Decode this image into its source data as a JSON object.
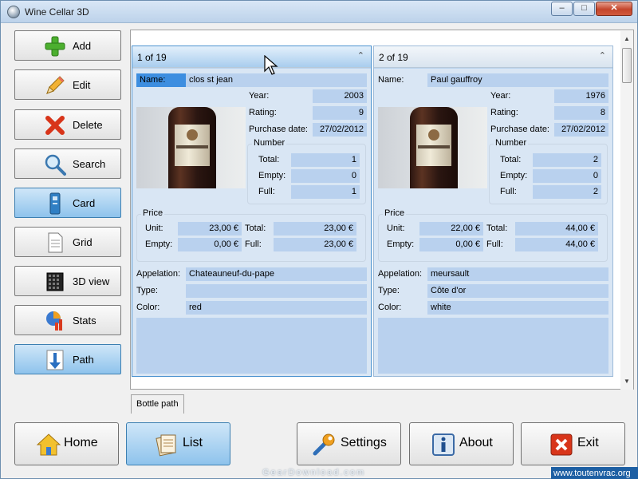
{
  "window": {
    "title": "Wine Cellar 3D",
    "minimize": "–",
    "maximize": "□",
    "close": "✕"
  },
  "tools": [
    {
      "label": "Add",
      "icon": "add-icon",
      "active": false
    },
    {
      "label": "Edit",
      "icon": "pencil-icon",
      "active": false
    },
    {
      "label": "Delete",
      "icon": "delete-x-icon",
      "active": false
    },
    {
      "label": "Search",
      "icon": "magnifier-icon",
      "active": false
    },
    {
      "label": "Card",
      "icon": "card-icon",
      "active": true
    },
    {
      "label": "Grid",
      "icon": "document-icon",
      "active": false
    },
    {
      "label": "3D view",
      "icon": "cube-grid-icon",
      "active": false
    },
    {
      "label": "Stats",
      "icon": "chart-icon",
      "active": false
    },
    {
      "label": "Path",
      "icon": "path-arrow-icon",
      "active": true
    }
  ],
  "labels": {
    "name": "Name:",
    "year": "Year:",
    "rating": "Rating:",
    "purchase_date": "Purchase date:",
    "number": "Number",
    "total": "Total:",
    "empty": "Empty:",
    "full": "Full:",
    "price": "Price",
    "unit": "Unit:",
    "appelation": "Appelation:",
    "type": "Type:",
    "color": "Color:"
  },
  "cards": [
    {
      "counter": "1 of 19",
      "name": "clos st jean",
      "year": "2003",
      "rating": "9",
      "purchase_date": "27/02/2012",
      "number_total": "1",
      "number_empty": "0",
      "number_full": "1",
      "price_unit": "23,00 €",
      "price_empty": "0,00 €",
      "price_total": "23,00 €",
      "price_full": "23,00 €",
      "appelation": "Chateauneuf-du-pape",
      "type": "",
      "color": "red"
    },
    {
      "counter": "2 of 19",
      "name": "Paul gauffroy",
      "year": "1976",
      "rating": "8",
      "purchase_date": "27/02/2012",
      "number_total": "2",
      "number_empty": "0",
      "number_full": "2",
      "price_unit": "22,00 €",
      "price_empty": "0,00 €",
      "price_total": "44,00 €",
      "price_full": "44,00 €",
      "appelation": "meursault",
      "type": "Côte d'or",
      "color": "white"
    }
  ],
  "collapse_glyph": "⌃",
  "tab": {
    "label": "Bottle path"
  },
  "bottom": [
    {
      "label": "Home",
      "icon": "home-icon",
      "active": false
    },
    {
      "label": "List",
      "icon": "list-icon",
      "active": true
    },
    {
      "label": "Settings",
      "icon": "wrench-icon",
      "active": false
    },
    {
      "label": "About",
      "icon": "info-icon",
      "active": false
    },
    {
      "label": "Exit",
      "icon": "exit-icon",
      "active": false
    }
  ],
  "watermark": "GearDownload.com",
  "corner_link": "www.toutenvrac.org"
}
